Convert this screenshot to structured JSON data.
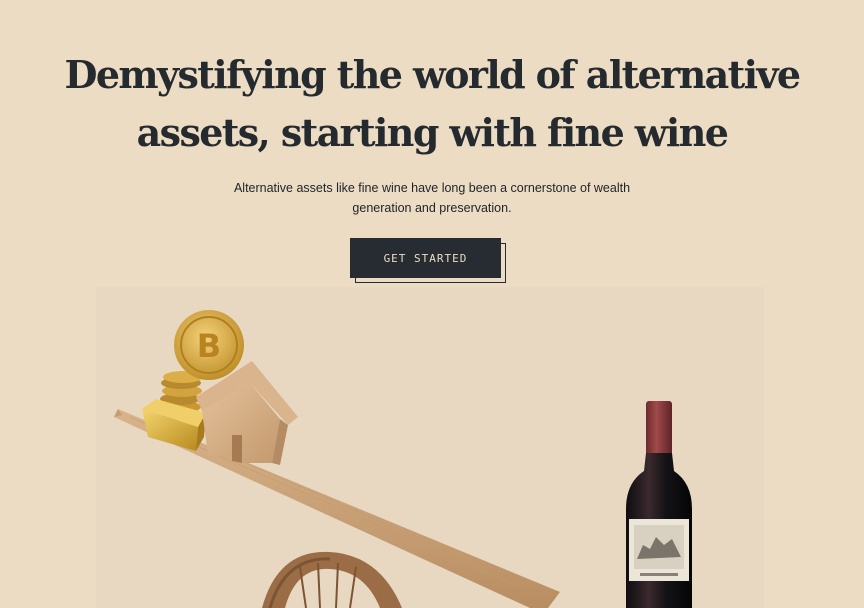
{
  "hero": {
    "title_line1": "Demystifying the world of alternative",
    "title_line2": "assets, starting with fine wine",
    "subtitle": "Alternative assets like fine wine have long been a cornerstone of wealth generation and preservation.",
    "cta_label": "GET STARTED"
  },
  "illustration": {
    "icons": [
      "bitcoin-coin-icon",
      "gold-coin-stack-icon",
      "gold-bar-icon",
      "wooden-house-icon",
      "seesaw-plank-icon",
      "wine-bottle-icon"
    ]
  },
  "colors": {
    "background": "#ecdcc4",
    "text": "#252a2f",
    "button": "#262c32",
    "wine_capsule": "#8a3a3c",
    "wood": "#c9a37a",
    "gold": "#d4a63a"
  }
}
